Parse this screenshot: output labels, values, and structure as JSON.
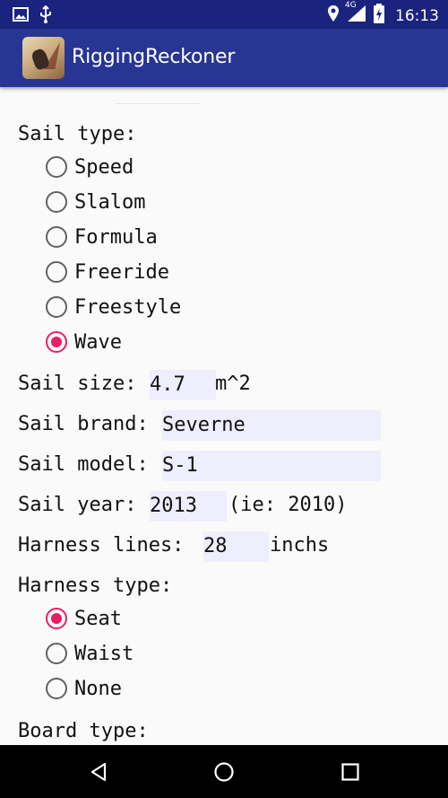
{
  "status_bar": {
    "time": "16:13",
    "network": "4G",
    "icons": [
      "image-icon",
      "usb-icon",
      "location-icon",
      "signal-icon",
      "battery-charging-icon"
    ]
  },
  "app_bar": {
    "title": "RiggingReckoner"
  },
  "form": {
    "sail_type_label": "Sail type:",
    "sail_type_options": [
      "Speed",
      "Slalom",
      "Formula",
      "Freeride",
      "Freestyle",
      "Wave"
    ],
    "sail_type_selected": "Wave",
    "sail_size_label": "Sail size:",
    "sail_size_value": "4.7",
    "sail_size_unit": "m^2",
    "sail_brand_label": "Sail brand:",
    "sail_brand_value": "Severne",
    "sail_model_label": "Sail model:",
    "sail_model_value": "S-1",
    "sail_year_label": "Sail year:",
    "sail_year_value": "2013",
    "sail_year_hint": "(ie: 2010)",
    "harness_lines_label": "Harness lines:",
    "harness_lines_value": "28",
    "harness_lines_unit": "inchs",
    "harness_type_label": "Harness type:",
    "harness_type_options": [
      "Seat",
      "Waist",
      "None"
    ],
    "harness_type_selected": "Seat",
    "board_type_label": "Board type:"
  },
  "colors": {
    "status_bar": "#1a237e",
    "app_bar": "#283593",
    "accent": "#e91e63",
    "field_bg": "#eeeefc"
  }
}
